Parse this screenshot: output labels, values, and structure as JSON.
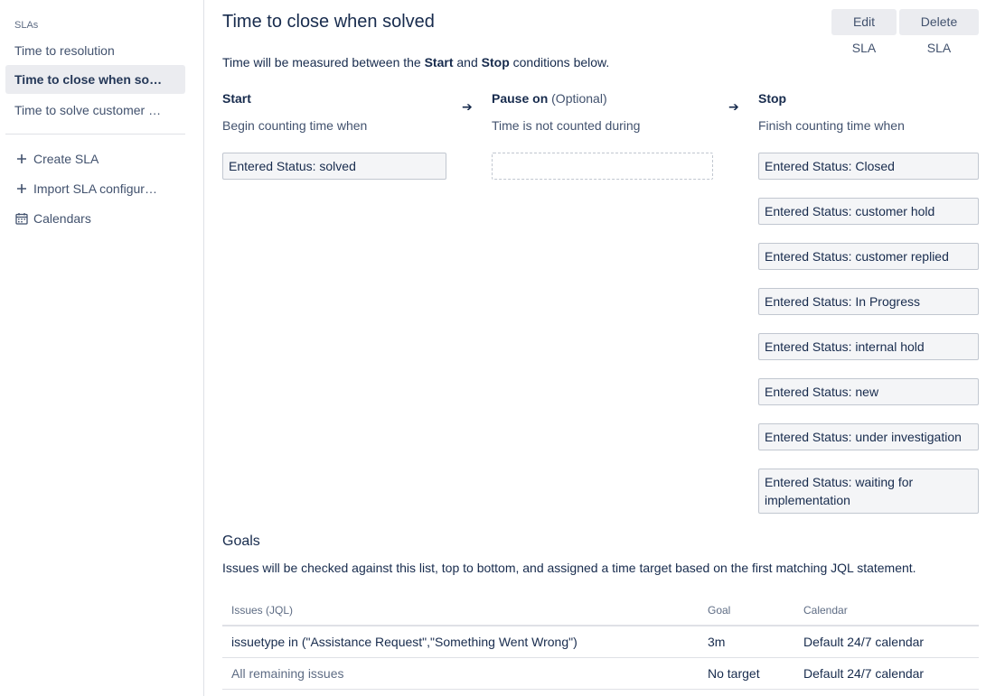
{
  "sidebar": {
    "section_title": "SLAs",
    "items": [
      {
        "label": "Time to resolution"
      },
      {
        "label": "Time to close when solved"
      },
      {
        "label": "Time to solve customer issues"
      }
    ],
    "actions": [
      {
        "label": "Create SLA",
        "icon": "plus-icon"
      },
      {
        "label": "Import SLA configuration",
        "icon": "plus-icon"
      },
      {
        "label": "Calendars",
        "icon": "calendar-icon"
      }
    ]
  },
  "header": {
    "title": "Time to close when solved",
    "edit_label": "Edit SLA",
    "delete_label": "Delete SLA"
  },
  "intro": {
    "prefix": "Time will be measured between the ",
    "start_word": "Start",
    "middle": " and ",
    "stop_word": "Stop",
    "suffix": " conditions below."
  },
  "columns": {
    "start": {
      "title": "Start",
      "subtitle": "Begin counting time when",
      "conditions": [
        "Entered Status: solved"
      ]
    },
    "pause": {
      "title": "Pause on",
      "optional": "(Optional)",
      "subtitle": "Time is not counted during",
      "conditions": []
    },
    "stop": {
      "title": "Stop",
      "subtitle": "Finish counting time when",
      "conditions": [
        "Entered Status: Closed",
        "Entered Status: customer hold",
        "Entered Status: customer replied",
        "Entered Status: In Progress",
        "Entered Status: internal hold",
        "Entered Status: new",
        "Entered Status: under investigation",
        "Entered Status: waiting for implementation"
      ]
    },
    "arrow": "➔"
  },
  "goals": {
    "title": "Goals",
    "description": "Issues will be checked against this list, top to bottom, and assigned a time target based on the first matching JQL statement.",
    "headers": {
      "issues": "Issues (JQL)",
      "goal": "Goal",
      "calendar": "Calendar"
    },
    "rows": [
      {
        "issues": "issuetype in (\"Assistance Request\",\"Something Went Wrong\")",
        "goal": "3m",
        "calendar": "Default 24/7 calendar"
      },
      {
        "issues": "All remaining issues",
        "goal": "No target",
        "calendar": "Default 24/7 calendar"
      }
    ]
  }
}
